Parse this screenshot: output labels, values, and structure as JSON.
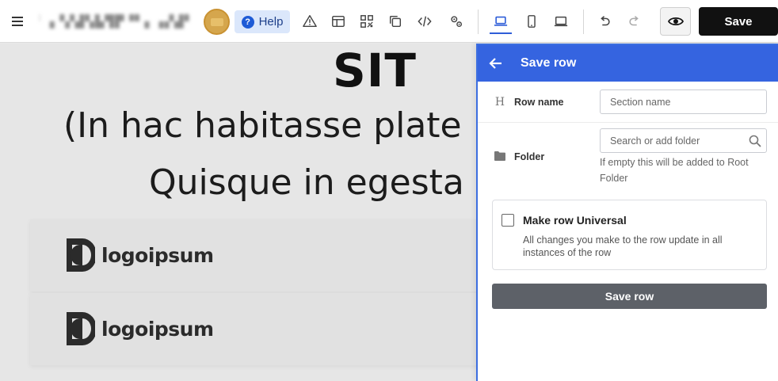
{
  "toolbar": {
    "menu_icon": "hamburger-icon",
    "site_name": "▖▌▘▗▝▞▟▚▙▜▛▝▘▖▗▞▟▘▚ ▌",
    "help_label": "Help",
    "help_icon": "question-circle-icon",
    "tools": [
      "warning-icon",
      "layout-icon",
      "qr-code-icon",
      "copy-icon",
      "code-icon",
      "settings-cogs-icon"
    ],
    "devices": [
      "laptop-icon",
      "mobile-icon",
      "tablet-icon"
    ],
    "active_device": "laptop-icon",
    "undo_icon": "undo-icon",
    "redo_icon": "redo-icon",
    "preview_icon": "eye-icon",
    "save_label": "Save"
  },
  "canvas": {
    "hero_title": "SIT",
    "hero_line1": "(In hac habitasse plate",
    "hero_line2": "Quisque in egesta",
    "logos": [
      {
        "text": "logoipsum"
      },
      {
        "text": "logoipsum"
      }
    ]
  },
  "panel": {
    "title": "Save row",
    "back_icon": "arrow-left-icon",
    "row_name": {
      "label": "Row name",
      "icon": "heading-icon",
      "icon_glyph": "H",
      "placeholder": "Section name",
      "value": ""
    },
    "folder": {
      "label": "Folder",
      "icon": "folder-icon",
      "placeholder": "Search or add folder",
      "value": "",
      "hint": "If empty this will be added to Root Folder"
    },
    "universal": {
      "label": "Make row Universal",
      "checked": false,
      "description": "All changes you make to the row update in all instances of the row"
    },
    "save_row_label": "Save row"
  },
  "colors": {
    "accent": "#3564e0",
    "save_button": "#111111",
    "save_row_button": "#5d6168",
    "help_bg": "#dbe7fb"
  }
}
